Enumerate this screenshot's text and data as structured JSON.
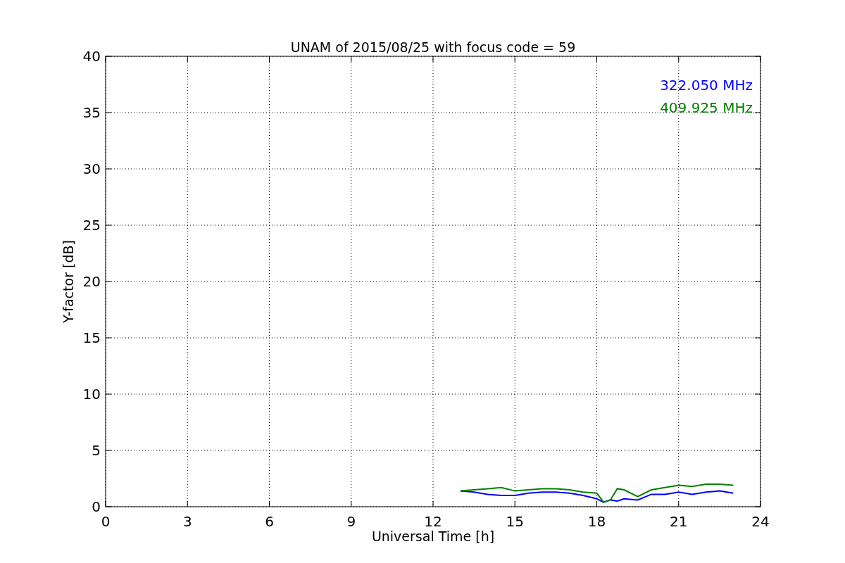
{
  "chart_data": {
    "type": "line",
    "title": "UNAM of 2015/08/25 with focus code = 59",
    "xlabel": "Universal Time [h]",
    "ylabel": "Y-factor [dB]",
    "x": [
      13,
      13.5,
      14,
      14.5,
      15,
      15.5,
      16,
      16.5,
      17,
      17.5,
      18,
      18.25,
      18.5,
      18.75,
      19,
      19.5,
      20,
      20.5,
      21,
      21.5,
      22,
      22.5,
      23
    ],
    "series": [
      {
        "name": "322.050 MHz",
        "color": "#0000ff",
        "values": [
          1.4,
          1.3,
          1.1,
          1.0,
          1.0,
          1.2,
          1.3,
          1.3,
          1.2,
          1.0,
          0.7,
          0.4,
          0.6,
          0.5,
          0.7,
          0.6,
          1.1,
          1.1,
          1.3,
          1.1,
          1.3,
          1.4,
          1.2
        ]
      },
      {
        "name": "409.925 MHz",
        "color": "#008000",
        "values": [
          1.4,
          1.5,
          1.6,
          1.7,
          1.4,
          1.5,
          1.6,
          1.6,
          1.5,
          1.3,
          1.2,
          0.4,
          0.6,
          1.6,
          1.5,
          0.9,
          1.5,
          1.7,
          1.9,
          1.8,
          2.0,
          2.0,
          1.9
        ]
      }
    ],
    "grid": true,
    "xlim": [
      0,
      24
    ],
    "ylim": [
      0,
      40
    ],
    "xticks": [
      0,
      3,
      6,
      9,
      12,
      15,
      18,
      21,
      24
    ],
    "yticks": [
      0,
      5,
      10,
      15,
      20,
      25,
      30,
      35,
      40
    ]
  }
}
